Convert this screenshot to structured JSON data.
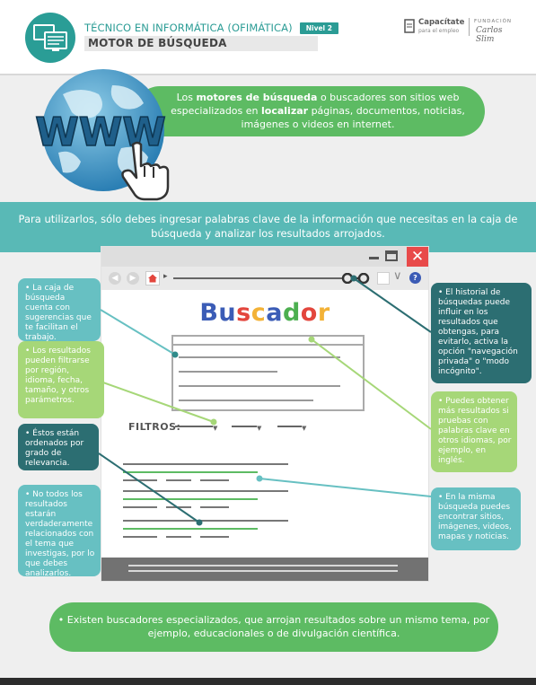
{
  "header": {
    "course_title": "TÉCNICO EN INFORMÁTICA (OFIMÁTICA)",
    "level": "Nivel 2",
    "topic_title": "MOTOR DE BÚSQUEDA",
    "brand_capacitate": "Capacítate",
    "brand_capacitate_sub": "para el empleo",
    "brand_fundacion": "FUNDACIÓN",
    "brand_carlos_slim": "Carlos Slim",
    "logo_icon": "computer-monitors-icon"
  },
  "intro": {
    "text_1": "Los ",
    "bold_1": "motores de búsqueda",
    "text_2": " o buscadores son sitios web especializados en ",
    "bold_2": "localizar",
    "text_3": " páginas, documentos, noticias, imágenes o videos en internet.",
    "globe_label": "WWW",
    "cursor_icon": "hand-pointer-icon"
  },
  "banner": {
    "text": "Para utilizarlos, sólo debes ingresar palabras clave de la información que necesitas en la caja de búsqueda y analizar los resultados arrojados."
  },
  "browser": {
    "window_buttons": [
      "minimize-icon",
      "maximize-icon",
      "close-icon"
    ],
    "close_glyph": "✕",
    "back_glyph": "◀",
    "forward_glyph": "▶",
    "nav_arrow": "▸",
    "dropdown_glyph": "∨",
    "help_glyph": "?",
    "logo_letters": [
      {
        "ch": "B",
        "color": "#3b5cb6"
      },
      {
        "ch": "u",
        "color": "#3b5cb6"
      },
      {
        "ch": "s",
        "color": "#e3463d"
      },
      {
        "ch": "c",
        "color": "#f3b237"
      },
      {
        "ch": "a",
        "color": "#3b5cb6"
      },
      {
        "ch": "d",
        "color": "#4caf50"
      },
      {
        "ch": "o",
        "color": "#e3463d"
      },
      {
        "ch": "r",
        "color": "#f3b237"
      }
    ],
    "filters_label": "FILTROS:",
    "filter_arrow": "▼"
  },
  "callouts": {
    "search_box": "• La caja de búsqueda cuenta con sugerencias que te facilitan el trabajo.",
    "filters": "• Los resultados pueden filtrarse por región, idioma, fecha, tamaño, y otros parámetros.",
    "relevance": "• Éstos están ordenados por grado de relevancia.",
    "not_related": "• No todos los resultados estarán verdaderamente relacionados con el tema que investigas, por lo que debes analizarlos.",
    "history": "• El historial de búsquedas puede influir en los resultados que obtengas, para evitarlo, activa la opción \"navegación privada\" o \"modo incógnito\".",
    "languages": "• Puedes obtener más resultados si pruebas con palabras clave en otros idiomas, por ejemplo, en inglés.",
    "media": "• En la misma búsqueda puedes encontrar sitios, imágenes, videos, mapas y noticias."
  },
  "bottom": {
    "text": "• Existen buscadores especializados, que arrojan resultados sobre un mismo tema, por ejemplo, educacionales o de divulgación científica."
  },
  "colors": {
    "teal": "#2b9c95",
    "green": "#5dbb63",
    "light_teal": "#67c0c2",
    "dark_teal": "#2c6e72",
    "light_green": "#a6d778",
    "close_red": "#e84a4a"
  }
}
